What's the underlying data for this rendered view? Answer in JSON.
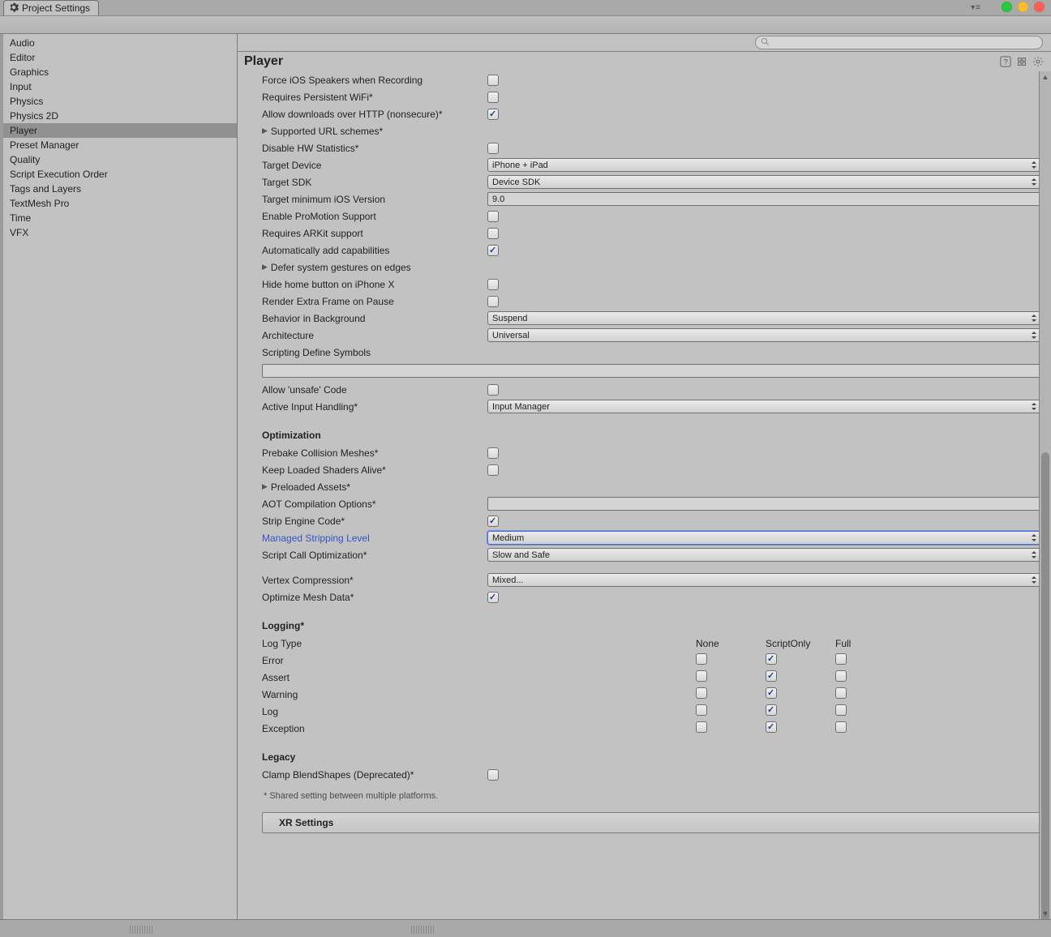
{
  "window": {
    "title": "Project Settings"
  },
  "sidebar": {
    "items": [
      "Audio",
      "Editor",
      "Graphics",
      "Input",
      "Physics",
      "Physics 2D",
      "Player",
      "Preset Manager",
      "Quality",
      "Script Execution Order",
      "Tags and Layers",
      "TextMesh Pro",
      "Time",
      "VFX"
    ],
    "selectedIndex": 6
  },
  "search": {
    "placeholder": ""
  },
  "header": {
    "title": "Player"
  },
  "settings": {
    "forceIosSpeakers": {
      "label": "Force iOS Speakers when Recording",
      "checked": false
    },
    "requiresWifi": {
      "label": "Requires Persistent WiFi*",
      "checked": false
    },
    "allowHttp": {
      "label": "Allow downloads over HTTP (nonsecure)*",
      "checked": true
    },
    "supportedUrl": {
      "label": "Supported URL schemes*"
    },
    "disableHw": {
      "label": "Disable HW Statistics*",
      "checked": false
    },
    "targetDevice": {
      "label": "Target Device",
      "value": "iPhone + iPad"
    },
    "targetSdk": {
      "label": "Target SDK",
      "value": "Device SDK"
    },
    "targetMinIos": {
      "label": "Target minimum iOS Version",
      "value": "9.0"
    },
    "proMotion": {
      "label": "Enable ProMotion Support",
      "checked": false
    },
    "arkit": {
      "label": "Requires ARKit support",
      "checked": false
    },
    "autoCaps": {
      "label": "Automatically add capabilities",
      "checked": true
    },
    "deferGestures": {
      "label": "Defer system gestures on edges"
    },
    "hideHome": {
      "label": "Hide home button on iPhone X",
      "checked": false
    },
    "extraFrame": {
      "label": "Render Extra Frame on Pause",
      "checked": false
    },
    "behaviorBg": {
      "label": "Behavior in Background",
      "value": "Suspend"
    },
    "arch": {
      "label": "Architecture",
      "value": "Universal"
    },
    "scriptSymbols": {
      "label": "Scripting Define Symbols",
      "value": ""
    },
    "allowUnsafe": {
      "label": "Allow 'unsafe' Code",
      "checked": false
    },
    "inputHandling": {
      "label": "Active Input Handling*",
      "value": "Input Manager"
    }
  },
  "optimization": {
    "title": "Optimization",
    "prebake": {
      "label": "Prebake Collision Meshes*",
      "checked": false
    },
    "keepShaders": {
      "label": "Keep Loaded Shaders Alive*",
      "checked": false
    },
    "preloaded": {
      "label": "Preloaded Assets*"
    },
    "aot": {
      "label": "AOT Compilation Options*",
      "value": ""
    },
    "stripEngine": {
      "label": "Strip Engine Code*",
      "checked": true
    },
    "managedStripping": {
      "label": "Managed Stripping Level",
      "value": "Medium"
    },
    "scriptCall": {
      "label": "Script Call Optimization*",
      "value": "Slow and Safe"
    },
    "vertexComp": {
      "label": "Vertex Compression*",
      "value": "Mixed..."
    },
    "optimizeMesh": {
      "label": "Optimize Mesh Data*",
      "checked": true
    }
  },
  "logging": {
    "title": "Logging*",
    "headers": {
      "type": "Log Type",
      "none": "None",
      "scriptOnly": "ScriptOnly",
      "full": "Full"
    },
    "rows": [
      {
        "label": "Error",
        "none": false,
        "scriptOnly": true,
        "full": false
      },
      {
        "label": "Assert",
        "none": false,
        "scriptOnly": true,
        "full": false
      },
      {
        "label": "Warning",
        "none": false,
        "scriptOnly": true,
        "full": false
      },
      {
        "label": "Log",
        "none": false,
        "scriptOnly": true,
        "full": false
      },
      {
        "label": "Exception",
        "none": false,
        "scriptOnly": true,
        "full": false
      }
    ]
  },
  "legacy": {
    "title": "Legacy",
    "clamp": {
      "label": "Clamp BlendShapes (Deprecated)*",
      "checked": false
    }
  },
  "footnote": "* Shared setting between multiple platforms.",
  "xr": {
    "title": "XR Settings"
  }
}
